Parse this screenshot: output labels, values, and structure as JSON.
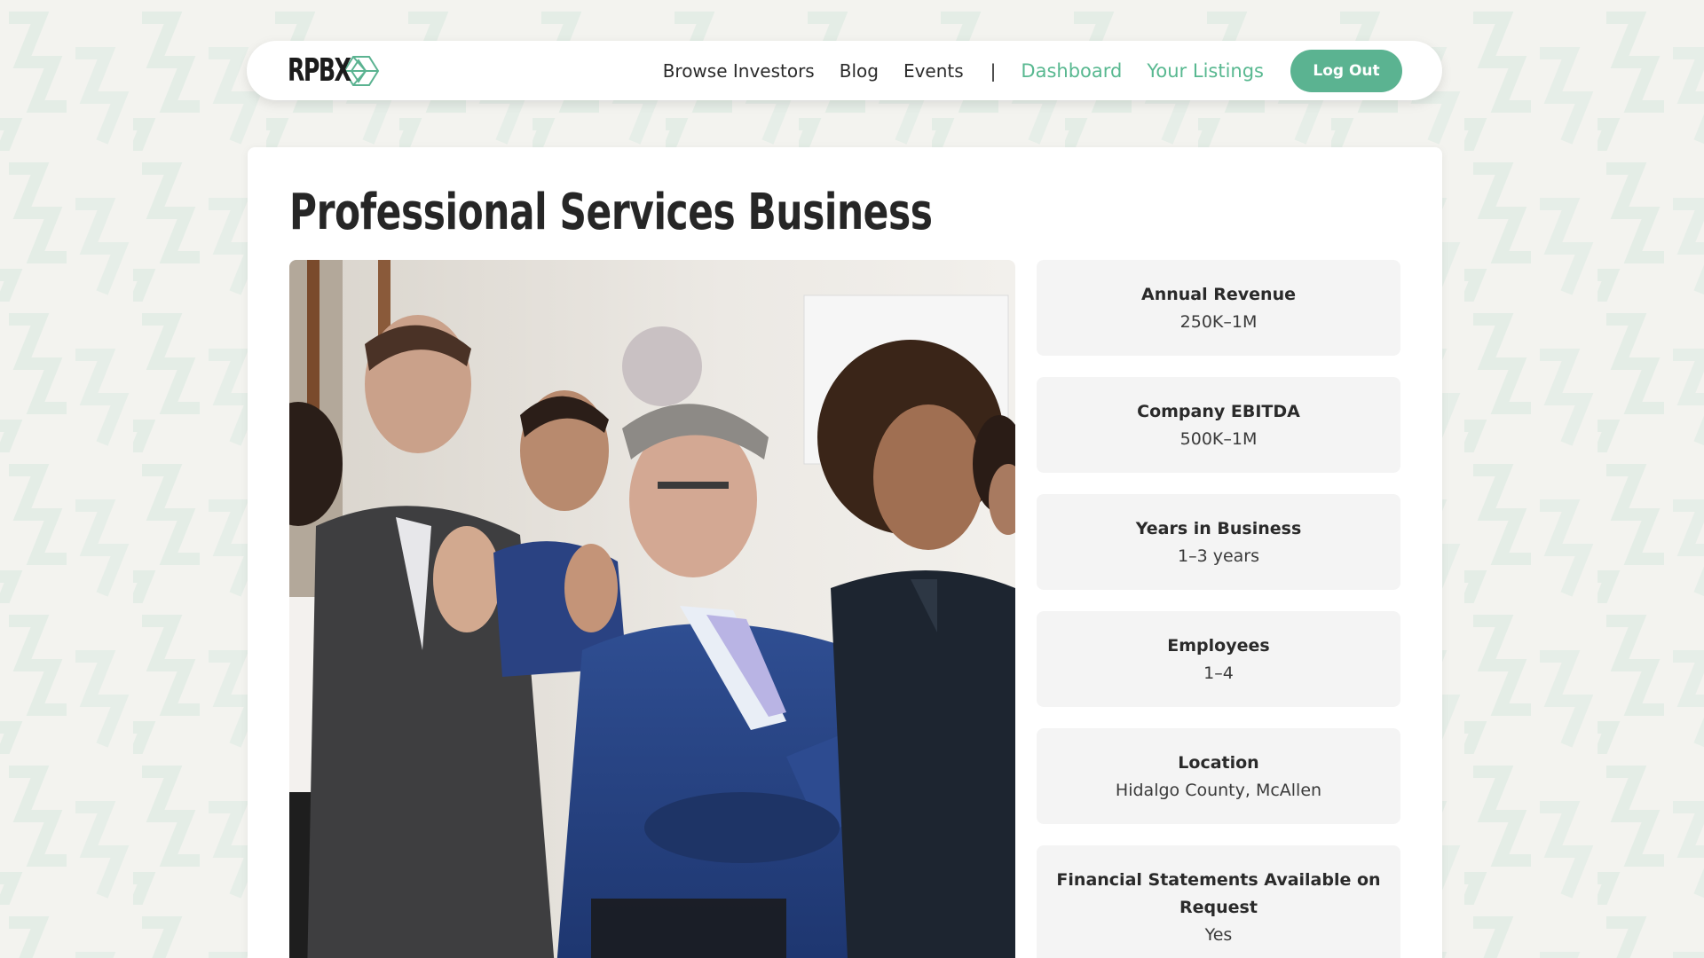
{
  "nav": {
    "logo_text": "RPBX",
    "links": [
      {
        "label": "Browse Investors"
      },
      {
        "label": "Blog"
      },
      {
        "label": "Events"
      }
    ],
    "separator": "|",
    "account_links": [
      {
        "label": "Dashboard"
      },
      {
        "label": "Your Listings"
      }
    ],
    "logout_label": "Log Out"
  },
  "listing": {
    "title": "Professional Services Business",
    "stats": [
      {
        "label": "Annual Revenue",
        "value": "250K–1M"
      },
      {
        "label": "Company EBITDA",
        "value": "500K–1M"
      },
      {
        "label": "Years in Business",
        "value": "1–3 years"
      },
      {
        "label": "Employees",
        "value": "1–4"
      },
      {
        "label": "Location",
        "value": "Hidalgo County, McAllen"
      },
      {
        "label": "Financial Statements Available on Request",
        "value": "Yes"
      }
    ]
  },
  "colors": {
    "accent": "#58b890",
    "button": "#5bb391",
    "background": "#f3f3ef",
    "stat_bg": "#f4f4f4"
  },
  "icons": [
    "rpbx-logo-mark-icon"
  ]
}
